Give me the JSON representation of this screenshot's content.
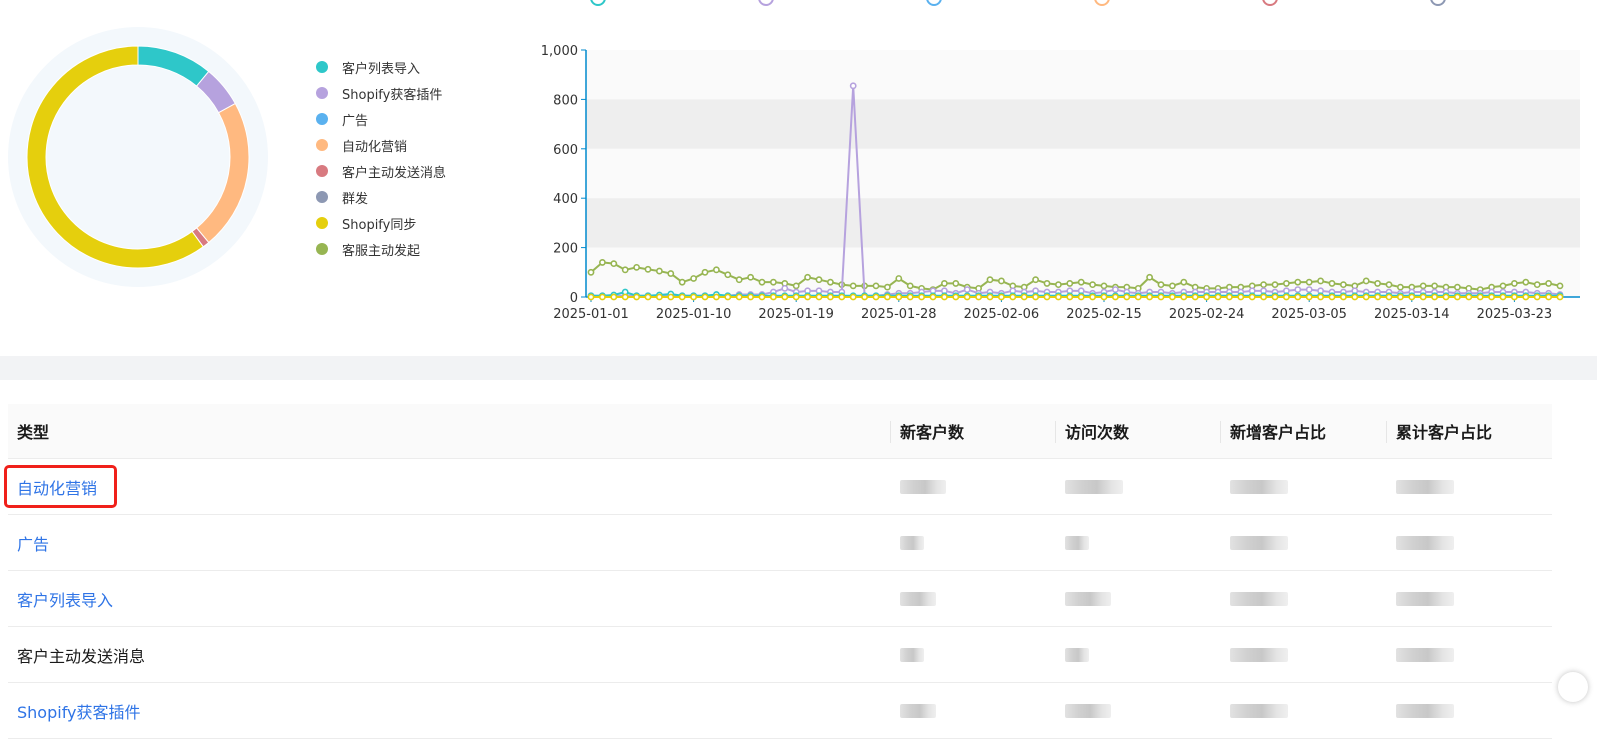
{
  "colors": {
    "teal": "#2ec7c9",
    "purple": "#b6a2de",
    "blue": "#5ab1ef",
    "orange": "#ffb980",
    "red": "#d87a80",
    "slate": "#8d98b3",
    "yellow": "#e5cf0d",
    "green": "#97b552",
    "link": "#2f74e6",
    "highlight": "#f0201a"
  },
  "legend": {
    "items": [
      {
        "label": "客户列表导入",
        "color": "#2ec7c9"
      },
      {
        "label": "Shopify获客插件",
        "color": "#b6a2de"
      },
      {
        "label": "广告",
        "color": "#5ab1ef"
      },
      {
        "label": "自动化营销",
        "color": "#ffb980"
      },
      {
        "label": "客户主动发送消息",
        "color": "#d87a80"
      },
      {
        "label": "群发",
        "color": "#8d98b3"
      },
      {
        "label": "Shopify同步",
        "color": "#e5cf0d"
      },
      {
        "label": "客服主动发起",
        "color": "#97b552"
      }
    ]
  },
  "chart_data": [
    {
      "type": "pie",
      "categories": [
        "客户列表导入",
        "Shopify获客插件",
        "广告",
        "自动化营销",
        "客户主动发送消息",
        "群发",
        "Shopify同步",
        "客服主动发起"
      ],
      "values": [
        11,
        6,
        0,
        22,
        1,
        0,
        60,
        0
      ]
    },
    {
      "type": "line",
      "ylim": [
        0,
        1000
      ],
      "y_ticks": [
        "1,000",
        "800",
        "600",
        "400",
        "200",
        "0"
      ],
      "x_ticks": [
        "2025-01-01",
        "2025-01-10",
        "2025-01-19",
        "2025-01-28",
        "2025-02-06",
        "2025-02-15",
        "2025-02-24",
        "2025-03-05",
        "2025-03-14",
        "2025-03-23"
      ],
      "x_start": "2025-01-01",
      "points_count": 86,
      "series": [
        {
          "name": "客服主动发起",
          "color": "#97b552",
          "values": [
            100,
            140,
            135,
            110,
            120,
            112,
            105,
            95,
            60,
            75,
            100,
            110,
            90,
            70,
            80,
            60,
            60,
            55,
            45,
            80,
            70,
            60,
            50,
            45,
            45,
            45,
            40,
            75,
            45,
            35,
            30,
            55,
            55,
            40,
            35,
            70,
            65,
            45,
            40,
            70,
            55,
            50,
            55,
            60,
            50,
            45,
            40,
            40,
            35,
            80,
            50,
            45,
            60,
            40,
            35,
            35,
            40,
            40,
            45,
            50,
            50,
            55,
            60,
            60,
            65,
            55,
            50,
            45,
            65,
            55,
            50,
            40,
            40,
            45,
            45,
            40,
            40,
            35,
            30,
            40,
            45,
            55,
            60,
            50,
            55,
            45
          ]
        },
        {
          "name": "Shopify获客插件",
          "color": "#b6a2de",
          "values": [
            5,
            5,
            5,
            5,
            5,
            5,
            5,
            5,
            5,
            5,
            5,
            5,
            5,
            10,
            10,
            10,
            20,
            35,
            20,
            25,
            25,
            20,
            20,
            855,
            5,
            5,
            10,
            15,
            15,
            20,
            25,
            25,
            15,
            30,
            15,
            20,
            15,
            25,
            20,
            25,
            20,
            20,
            25,
            25,
            15,
            20,
            30,
            20,
            15,
            20,
            20,
            15,
            20,
            20,
            20,
            20,
            20,
            20,
            25,
            25,
            20,
            25,
            30,
            30,
            25,
            20,
            20,
            25,
            20,
            20,
            20,
            15,
            20,
            20,
            20,
            20,
            15,
            15,
            15,
            20,
            20,
            20,
            20,
            15,
            15,
            10
          ]
        },
        {
          "name": "客户列表导入",
          "color": "#2ec7c9",
          "values": [
            5,
            5,
            8,
            20,
            5,
            5,
            8,
            12,
            5,
            5,
            5,
            10,
            5,
            5,
            5,
            5,
            5,
            5,
            5,
            5,
            5,
            5,
            5,
            5,
            5,
            5,
            5,
            5,
            5,
            5,
            5,
            5,
            5,
            5,
            5,
            5,
            5,
            5,
            5,
            5,
            5,
            5,
            5,
            5,
            5,
            5,
            5,
            5,
            5,
            5,
            5,
            5,
            5,
            5,
            5,
            5,
            5,
            5,
            5,
            5,
            5,
            5,
            5,
            5,
            5,
            5,
            5,
            5,
            5,
            5,
            5,
            5,
            5,
            5,
            5,
            5,
            5,
            5,
            5,
            5,
            5,
            5,
            5,
            5,
            5,
            5
          ]
        },
        {
          "name": "Shopify同步",
          "color": "#e5cf0d",
          "values": [
            0,
            0,
            0,
            0,
            0,
            0,
            0,
            0,
            0,
            0,
            0,
            0,
            0,
            0,
            0,
            0,
            0,
            0,
            0,
            0,
            0,
            0,
            0,
            0,
            0,
            0,
            0,
            0,
            0,
            0,
            0,
            0,
            0,
            0,
            0,
            0,
            0,
            0,
            0,
            0,
            0,
            0,
            0,
            0,
            0,
            0,
            0,
            0,
            0,
            0,
            0,
            0,
            0,
            0,
            0,
            0,
            0,
            0,
            0,
            0,
            0,
            0,
            0,
            0,
            0,
            0,
            0,
            0,
            0,
            0,
            0,
            0,
            0,
            0,
            0,
            0,
            0,
            0,
            0,
            0,
            0,
            0,
            0,
            0,
            0,
            0
          ]
        }
      ]
    }
  ],
  "table": {
    "headers": [
      "类型",
      "新客户数",
      "访问次数",
      "新增客户占比",
      "累计客户占比"
    ],
    "rows": [
      {
        "type": "自动化营销",
        "link": true
      },
      {
        "type": "广告",
        "link": true
      },
      {
        "type": "客户列表导入",
        "link": true
      },
      {
        "type": "客户主动发送消息",
        "link": false
      },
      {
        "type": "Shopify获客插件",
        "link": true
      }
    ]
  }
}
